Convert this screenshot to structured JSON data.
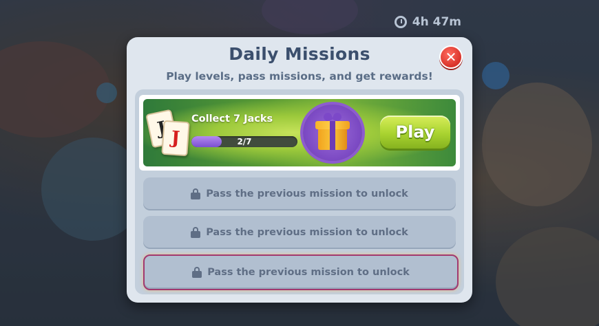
{
  "timer": {
    "icon": "clock-icon",
    "text": "4h 47m"
  },
  "modal": {
    "title": "Daily Missions",
    "subtitle": "Play levels, pass missions, and get rewards!",
    "close_icon": "close-icon"
  },
  "active_mission": {
    "label": "Collect 7 Jacks",
    "card_back_letter": "J",
    "card_front_letter": "J",
    "progress_text": "2/7",
    "progress_current": 2,
    "progress_total": 7,
    "reward_icon": "gift-icon",
    "play_label": "Play"
  },
  "locked_missions": [
    {
      "text": "Pass the previous mission to unlock",
      "icon": "lock-icon"
    },
    {
      "text": "Pass the previous mission to unlock",
      "icon": "lock-icon"
    },
    {
      "text": "Pass the previous mission to unlock",
      "icon": "lock-icon"
    }
  ],
  "colors": {
    "title": "#3b4f6d",
    "play_button": "#a9d330",
    "close_button": "#d8322a",
    "progress_fill": "#7b4fd0",
    "highlight_border": "#a2386e"
  }
}
